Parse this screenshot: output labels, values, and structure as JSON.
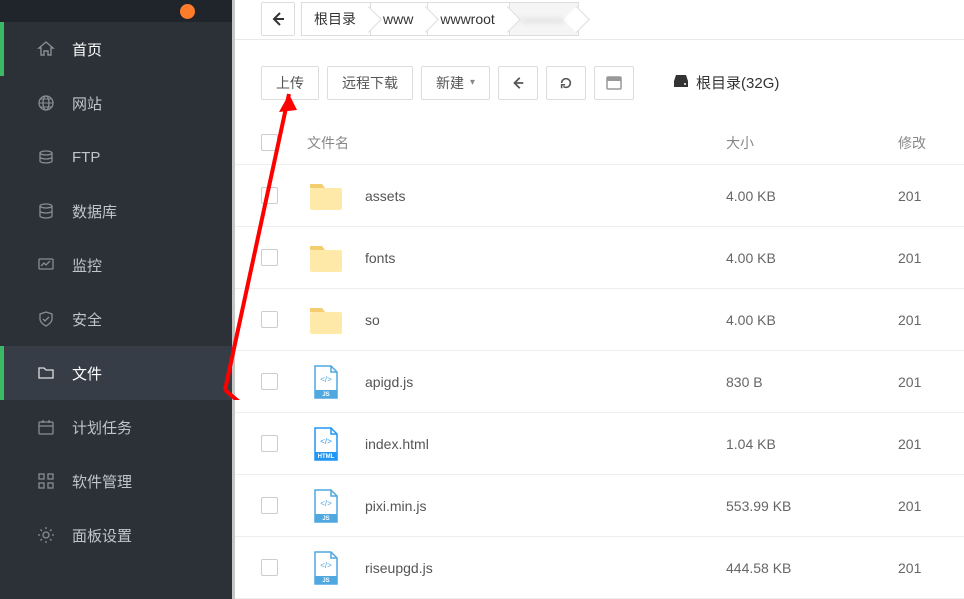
{
  "sidebar": {
    "items": [
      {
        "label": "首页",
        "icon": "home-icon",
        "active": true
      },
      {
        "label": "网站",
        "icon": "globe-icon",
        "active": false
      },
      {
        "label": "FTP",
        "icon": "ftp-icon",
        "active": false
      },
      {
        "label": "数据库",
        "icon": "database-icon",
        "active": false
      },
      {
        "label": "监控",
        "icon": "monitor-icon",
        "active": false
      },
      {
        "label": "安全",
        "icon": "shield-icon",
        "active": false
      },
      {
        "label": "文件",
        "icon": "folder-icon",
        "active": true
      },
      {
        "label": "计划任务",
        "icon": "calendar-icon",
        "active": false
      },
      {
        "label": "软件管理",
        "icon": "apps-icon",
        "active": false
      },
      {
        "label": "面板设置",
        "icon": "gear-icon",
        "active": false
      }
    ]
  },
  "breadcrumb": {
    "items": [
      "根目录",
      "www",
      "wwwroot",
      "———"
    ]
  },
  "toolbar": {
    "upload": "上传",
    "remote": "远程下载",
    "newbtn": "新建",
    "disk_label": "根目录(32G)"
  },
  "table": {
    "headers": {
      "name": "文件名",
      "size": "大小",
      "date": "修改"
    },
    "rows": [
      {
        "type": "folder",
        "name": "assets",
        "size": "4.00 KB",
        "date": "201"
      },
      {
        "type": "folder",
        "name": "fonts",
        "size": "4.00 KB",
        "date": "201"
      },
      {
        "type": "folder",
        "name": "so",
        "size": "4.00 KB",
        "date": "201"
      },
      {
        "type": "js",
        "name": "apigd.js",
        "size": "830 B",
        "date": "201"
      },
      {
        "type": "html",
        "name": "index.html",
        "size": "1.04 KB",
        "date": "201"
      },
      {
        "type": "js",
        "name": "pixi.min.js",
        "size": "553.99 KB",
        "date": "201"
      },
      {
        "type": "js",
        "name": "riseupgd.js",
        "size": "444.58 KB",
        "date": "201"
      }
    ]
  }
}
